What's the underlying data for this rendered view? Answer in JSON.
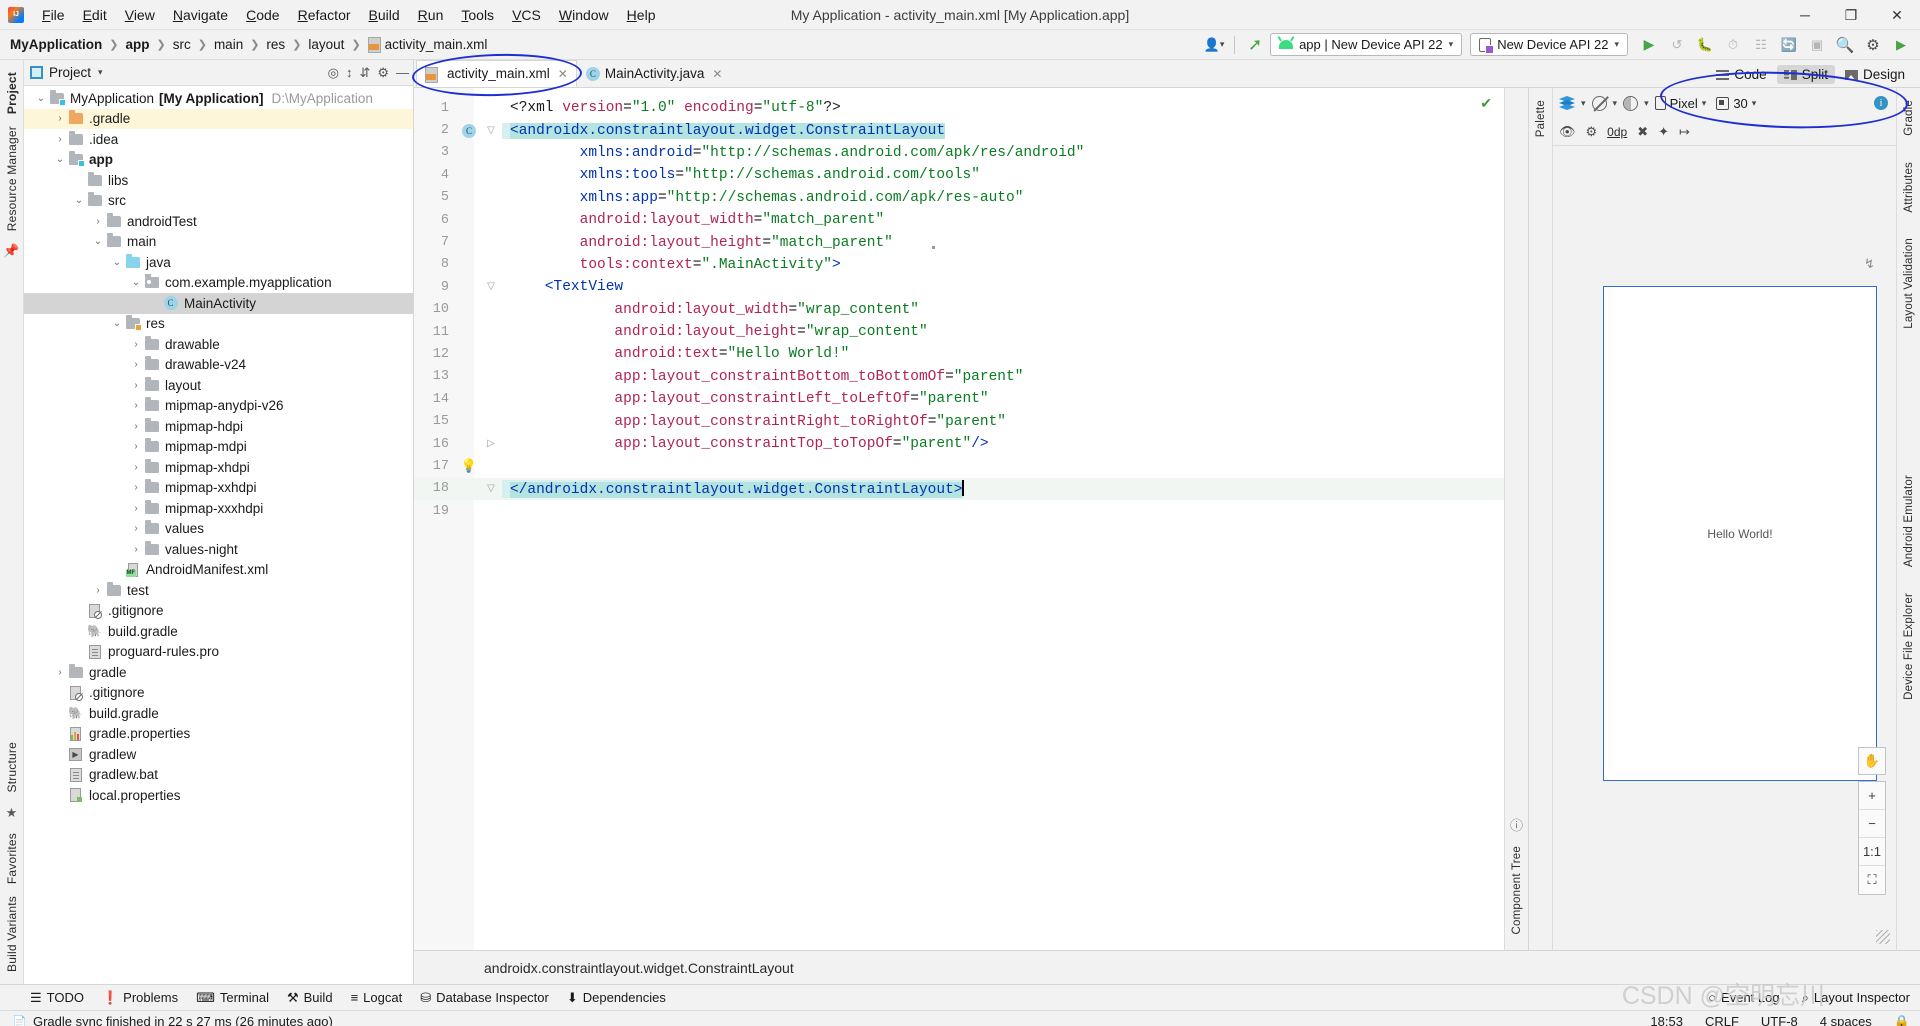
{
  "window": {
    "title": "My Application - activity_main.xml [My Application.app]",
    "minimize": "─",
    "maximize": "❐",
    "close": "✕"
  },
  "menu": [
    "File",
    "Edit",
    "View",
    "Navigate",
    "Code",
    "Refactor",
    "Build",
    "Run",
    "Tools",
    "VCS",
    "Window",
    "Help"
  ],
  "breadcrumb": {
    "items": [
      "MyApplication",
      "app",
      "src",
      "main",
      "res",
      "layout",
      "activity_main.xml"
    ]
  },
  "toolbar": {
    "run_config": "app | New Device API 22",
    "device": "New Device API 22",
    "caret": "▾"
  },
  "project_panel": {
    "title": "Project",
    "tree": [
      {
        "indent": 0,
        "arrow": "⌄",
        "icon": "module-folder",
        "label": "MyApplication",
        "bold_label": "[My Application]",
        "path": "D:\\MyApplication",
        "state": "normal"
      },
      {
        "indent": 1,
        "arrow": "›",
        "icon": "folder-orange",
        "label": ".gradle",
        "state": "highlight"
      },
      {
        "indent": 1,
        "arrow": "›",
        "icon": "folder",
        "label": ".idea",
        "state": "normal"
      },
      {
        "indent": 1,
        "arrow": "⌄",
        "icon": "module-folder",
        "label": "app",
        "bold": true,
        "state": "normal"
      },
      {
        "indent": 2,
        "arrow": "",
        "icon": "folder",
        "label": "libs",
        "state": "normal"
      },
      {
        "indent": 2,
        "arrow": "⌄",
        "icon": "folder",
        "label": "src",
        "state": "normal"
      },
      {
        "indent": 3,
        "arrow": "›",
        "icon": "folder",
        "label": "androidTest",
        "state": "normal"
      },
      {
        "indent": 3,
        "arrow": "⌄",
        "icon": "folder",
        "label": "main",
        "state": "normal"
      },
      {
        "indent": 4,
        "arrow": "⌄",
        "icon": "folder-cyan",
        "label": "java",
        "state": "normal"
      },
      {
        "indent": 5,
        "arrow": "⌄",
        "icon": "package",
        "label": "com.example.myapplication",
        "state": "normal"
      },
      {
        "indent": 6,
        "arrow": "",
        "icon": "class",
        "label": "MainActivity",
        "state": "selected"
      },
      {
        "indent": 4,
        "arrow": "⌄",
        "icon": "res-folder",
        "label": "res",
        "state": "normal"
      },
      {
        "indent": 5,
        "arrow": "›",
        "icon": "folder",
        "label": "drawable",
        "state": "normal"
      },
      {
        "indent": 5,
        "arrow": "›",
        "icon": "folder",
        "label": "drawable-v24",
        "state": "normal"
      },
      {
        "indent": 5,
        "arrow": "›",
        "icon": "folder",
        "label": "layout",
        "state": "normal"
      },
      {
        "indent": 5,
        "arrow": "›",
        "icon": "folder",
        "label": "mipmap-anydpi-v26",
        "state": "normal"
      },
      {
        "indent": 5,
        "arrow": "›",
        "icon": "folder",
        "label": "mipmap-hdpi",
        "state": "normal"
      },
      {
        "indent": 5,
        "arrow": "›",
        "icon": "folder",
        "label": "mipmap-mdpi",
        "state": "normal"
      },
      {
        "indent": 5,
        "arrow": "›",
        "icon": "folder",
        "label": "mipmap-xhdpi",
        "state": "normal"
      },
      {
        "indent": 5,
        "arrow": "›",
        "icon": "folder",
        "label": "mipmap-xxhdpi",
        "state": "normal"
      },
      {
        "indent": 5,
        "arrow": "›",
        "icon": "folder",
        "label": "mipmap-xxxhdpi",
        "state": "normal"
      },
      {
        "indent": 5,
        "arrow": "›",
        "icon": "folder",
        "label": "values",
        "state": "normal"
      },
      {
        "indent": 5,
        "arrow": "›",
        "icon": "folder",
        "label": "values-night",
        "state": "normal"
      },
      {
        "indent": 4,
        "arrow": "",
        "icon": "manifest",
        "label": "AndroidManifest.xml",
        "state": "normal"
      },
      {
        "indent": 3,
        "arrow": "›",
        "icon": "folder",
        "label": "test",
        "state": "normal"
      },
      {
        "indent": 2,
        "arrow": "",
        "icon": "gitignore",
        "label": ".gitignore",
        "state": "normal"
      },
      {
        "indent": 2,
        "arrow": "",
        "icon": "gradle-file",
        "label": "build.gradle",
        "state": "normal"
      },
      {
        "indent": 2,
        "arrow": "",
        "icon": "file",
        "label": "proguard-rules.pro",
        "state": "normal"
      },
      {
        "indent": 1,
        "arrow": "›",
        "icon": "folder",
        "label": "gradle",
        "state": "normal"
      },
      {
        "indent": 1,
        "arrow": "",
        "icon": "gitignore",
        "label": ".gitignore",
        "state": "normal"
      },
      {
        "indent": 1,
        "arrow": "",
        "icon": "gradle-file",
        "label": "build.gradle",
        "state": "normal"
      },
      {
        "indent": 1,
        "arrow": "",
        "icon": "gradle-properties",
        "label": "gradle.properties",
        "state": "normal"
      },
      {
        "indent": 1,
        "arrow": "",
        "icon": "shell",
        "label": "gradlew",
        "state": "normal"
      },
      {
        "indent": 1,
        "arrow": "",
        "icon": "file",
        "label": "gradlew.bat",
        "state": "normal"
      },
      {
        "indent": 1,
        "arrow": "",
        "icon": "local-properties",
        "label": "local.properties",
        "state": "normal"
      }
    ]
  },
  "left_rail": {
    "tabs": [
      "Project",
      "Resource Manager"
    ]
  },
  "left_rail_bottom": {
    "tabs": [
      "Structure",
      "Favorites",
      "Build Variants"
    ]
  },
  "right_rail": {
    "tabs": [
      "Gradle",
      "Attributes",
      "Layout Validation",
      "Android Emulator",
      "Device File Explorer"
    ]
  },
  "editor": {
    "tabs": [
      {
        "label": "activity_main.xml",
        "icon": "xml-layout-icon",
        "active": true,
        "close": "✕"
      },
      {
        "label": "MainActivity.java",
        "icon": "java-class-icon",
        "active": false,
        "close": "✕"
      }
    ],
    "view_modes": [
      {
        "label": "Code",
        "icon": "code-lines-icon",
        "active": false
      },
      {
        "label": "Split",
        "icon": "split-icon",
        "active": true
      },
      {
        "label": "Design",
        "icon": "design-icon",
        "active": false
      }
    ],
    "status_path": "androidx.constraintlayout.widget.ConstraintLayout",
    "lines": [
      {
        "n": 1,
        "segments": [
          {
            "t": "<?xml ",
            "c": "pi"
          },
          {
            "t": "version",
            "c": "attr"
          },
          {
            "t": "=",
            "c": "pi"
          },
          {
            "t": "\"1.0\"",
            "c": "str"
          },
          {
            "t": " ",
            "c": "pi"
          },
          {
            "t": "encoding",
            "c": "attr"
          },
          {
            "t": "=",
            "c": "pi"
          },
          {
            "t": "\"utf-8\"",
            "c": "str"
          },
          {
            "t": "?>",
            "c": "pi"
          }
        ]
      },
      {
        "n": 2,
        "gutter": "class-badge",
        "fold": "collapse",
        "highlight": true,
        "segments": [
          {
            "t": "<androidx.constraintlayout.widget.ConstraintLayout",
            "c": "tag"
          }
        ]
      },
      {
        "n": 3,
        "segments": [
          {
            "t": "        ",
            "c": "pi"
          },
          {
            "t": "xmlns:android",
            "c": "ns"
          },
          {
            "t": "=",
            "c": "pi"
          },
          {
            "t": "\"http://schemas.android.com/apk/res/android\"",
            "c": "str"
          }
        ]
      },
      {
        "n": 4,
        "segments": [
          {
            "t": "        ",
            "c": "pi"
          },
          {
            "t": "xmlns:tools",
            "c": "ns"
          },
          {
            "t": "=",
            "c": "pi"
          },
          {
            "t": "\"http://schemas.android.com/tools\"",
            "c": "str"
          }
        ]
      },
      {
        "n": 5,
        "segments": [
          {
            "t": "        ",
            "c": "pi"
          },
          {
            "t": "xmlns:app",
            "c": "ns"
          },
          {
            "t": "=",
            "c": "pi"
          },
          {
            "t": "\"http://schemas.android.com/apk/res-auto\"",
            "c": "str"
          }
        ]
      },
      {
        "n": 6,
        "segments": [
          {
            "t": "        ",
            "c": "pi"
          },
          {
            "t": "android:layout_width",
            "c": "attr"
          },
          {
            "t": "=",
            "c": "pi"
          },
          {
            "t": "\"match_parent\"",
            "c": "str"
          }
        ]
      },
      {
        "n": 7,
        "segments": [
          {
            "t": "        ",
            "c": "pi"
          },
          {
            "t": "android:layout_height",
            "c": "attr"
          },
          {
            "t": "=",
            "c": "pi"
          },
          {
            "t": "\"match_parent\"",
            "c": "str"
          }
        ]
      },
      {
        "n": 8,
        "segments": [
          {
            "t": "        ",
            "c": "pi"
          },
          {
            "t": "tools:context",
            "c": "attr"
          },
          {
            "t": "=",
            "c": "pi"
          },
          {
            "t": "\".MainActivity\"",
            "c": "str"
          },
          {
            "t": ">",
            "c": "tag"
          }
        ]
      },
      {
        "n": 9,
        "fold": "collapse",
        "segments": [
          {
            "t": "    ",
            "c": "pi"
          },
          {
            "t": "<TextView",
            "c": "tag"
          }
        ]
      },
      {
        "n": 10,
        "segments": [
          {
            "t": "            ",
            "c": "pi"
          },
          {
            "t": "android:layout_width",
            "c": "attr"
          },
          {
            "t": "=",
            "c": "pi"
          },
          {
            "t": "\"wrap_content\"",
            "c": "str"
          }
        ]
      },
      {
        "n": 11,
        "segments": [
          {
            "t": "            ",
            "c": "pi"
          },
          {
            "t": "android:layout_height",
            "c": "attr"
          },
          {
            "t": "=",
            "c": "pi"
          },
          {
            "t": "\"wrap_content\"",
            "c": "str"
          }
        ]
      },
      {
        "n": 12,
        "segments": [
          {
            "t": "            ",
            "c": "pi"
          },
          {
            "t": "android:text",
            "c": "attr"
          },
          {
            "t": "=",
            "c": "pi"
          },
          {
            "t": "\"Hello World!\"",
            "c": "str"
          }
        ]
      },
      {
        "n": 13,
        "segments": [
          {
            "t": "            ",
            "c": "pi"
          },
          {
            "t": "app:layout_constraintBottom_toBottomOf",
            "c": "attr"
          },
          {
            "t": "=",
            "c": "pi"
          },
          {
            "t": "\"parent\"",
            "c": "str"
          }
        ]
      },
      {
        "n": 14,
        "segments": [
          {
            "t": "            ",
            "c": "pi"
          },
          {
            "t": "app:layout_constraintLeft_toLeftOf",
            "c": "attr"
          },
          {
            "t": "=",
            "c": "pi"
          },
          {
            "t": "\"parent\"",
            "c": "str"
          }
        ]
      },
      {
        "n": 15,
        "segments": [
          {
            "t": "            ",
            "c": "pi"
          },
          {
            "t": "app:layout_constraintRight_toRightOf",
            "c": "attr"
          },
          {
            "t": "=",
            "c": "pi"
          },
          {
            "t": "\"parent\"",
            "c": "str"
          }
        ]
      },
      {
        "n": 16,
        "fold": "expand",
        "segments": [
          {
            "t": "            ",
            "c": "pi"
          },
          {
            "t": "app:layout_constraintTop_toTopOf",
            "c": "attr"
          },
          {
            "t": "=",
            "c": "pi"
          },
          {
            "t": "\"parent\"",
            "c": "str"
          },
          {
            "t": "/>",
            "c": "tag"
          }
        ]
      },
      {
        "n": 17,
        "gutter": "bulb",
        "segments": []
      },
      {
        "n": 18,
        "fold": "collapse",
        "current": true,
        "highlight": true,
        "caret": true,
        "segments": [
          {
            "t": "</androidx.constraintlayout.widget.ConstraintLayout>",
            "c": "tag"
          }
        ]
      },
      {
        "n": 19,
        "segments": []
      }
    ]
  },
  "component_tree": {
    "label": "Component Tree"
  },
  "design": {
    "device": "Pixel",
    "api": "30",
    "constraint_value": "0dp",
    "preview_text": "Hello World!",
    "zoom_reset": "1:1",
    "zoom_in": "+",
    "zoom_out": "−",
    "zoom_fit": "⛶",
    "pan_tool": "✋",
    "info_badge": "i"
  },
  "bottom_tools": {
    "left": [
      {
        "label": "TODO",
        "icon": "todo-icon"
      },
      {
        "label": "Problems",
        "icon": "problems-icon"
      },
      {
        "label": "Terminal",
        "icon": "terminal-icon"
      },
      {
        "label": "Build",
        "icon": "build-icon"
      },
      {
        "label": "Logcat",
        "icon": "logcat-icon"
      },
      {
        "label": "Database Inspector",
        "icon": "database-icon"
      },
      {
        "label": "Dependencies",
        "icon": "dependencies-icon"
      }
    ],
    "right": [
      {
        "label": "Event Log",
        "icon": "event-log-icon"
      },
      {
        "label": "Layout Inspector",
        "icon": "layout-inspector-icon"
      }
    ]
  },
  "status": {
    "message": "Gradle sync finished in 22 s 27 ms (26 minutes ago)",
    "time": "18:53",
    "line_sep": "CRLF",
    "encoding": "UTF-8",
    "indent": "4 spaces"
  },
  "watermark": "CSDN @空明忘川",
  "colors": {
    "accent": "#3592c4",
    "tag": "#0033b3",
    "attr": "#b32257",
    "string": "#0a7c22",
    "selection": "#b4e3e0",
    "annotation": "#1d2fd0"
  }
}
